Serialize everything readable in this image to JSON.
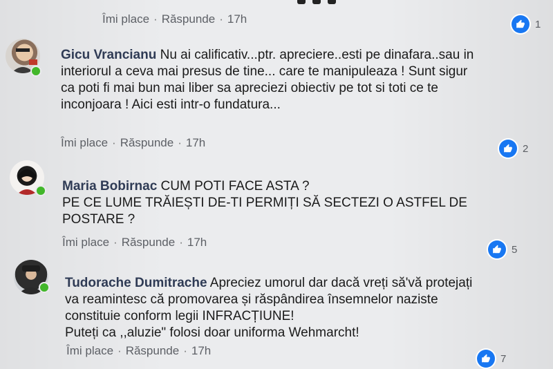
{
  "top_actions": {
    "like": "Îmi place",
    "reply": "Răspunde",
    "time": "17h",
    "reaction_count": "1"
  },
  "separator": "·",
  "comments": [
    {
      "author": "Gicu Vrancianu",
      "text_lines": [
        "Nu ai calificativ...ptr. apreciere..esti pe dinafara..sau in",
        "interiorul a ceva mai presus de tine... care te manipuleaza ! Sunt sigur",
        "ca poti fi mai bun mai liber sa apreciezi obiectiv pe tot si toti ce te",
        "inconjoara ! Aici esti intr-o fundatura..."
      ],
      "like": "Îmi place",
      "reply": "Răspunde",
      "time": "17h",
      "reaction_count": "2"
    },
    {
      "author": "Maria Bobirnac",
      "text_lines": [
        "CUM POTI FACE ASTA ?",
        "PE CE LUME TRĂIEȘTI DE-TI PERMIȚI SĂ SECTEZI O ASTFEL DE",
        "POSTARE ?"
      ],
      "like": "Îmi place",
      "reply": "Răspunde",
      "time": "17h",
      "reaction_count": "5"
    },
    {
      "author": "Tudorache Dumitrache",
      "text_lines": [
        "Apreciez umorul dar dacă vreți să'vă protejați",
        "va reamintesc că promovarea și răspândirea însemnelor naziste",
        "constituie conform legii INFRACȚIUNE!",
        "Puteți ca ,,aluzie\" folosi doar uniforma Wehmarcht!"
      ],
      "like": "Îmi place",
      "reply": "Răspunde",
      "time": "17h",
      "reaction_count": "7"
    }
  ],
  "colors": {
    "like_blue": "#1877f2",
    "online_green": "#42b72a",
    "author_color": "#2f3b55"
  },
  "icons": {
    "like": "thumbs-up-icon",
    "online": "online-indicator"
  }
}
